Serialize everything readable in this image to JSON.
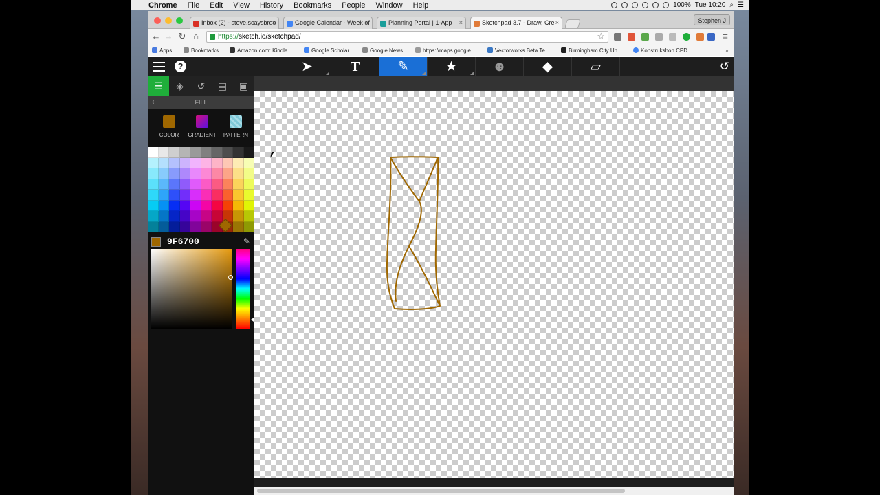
{
  "menubar": {
    "app_name": "Chrome",
    "items": [
      "File",
      "Edit",
      "View",
      "History",
      "Bookmarks",
      "People",
      "Window",
      "Help"
    ],
    "battery": "100%",
    "clock": "Tue 10:20"
  },
  "browser": {
    "profile": "Stephen J",
    "tabs": [
      {
        "title": "Inbox (2) - steve.scaysbroo",
        "favicon_color": "#d93025"
      },
      {
        "title": "Google Calendar - Week of",
        "favicon_color": "#4285f4"
      },
      {
        "title": "Planning Portal | 1-App",
        "favicon_color": "#1a9e9a"
      },
      {
        "title": "Sketchpad 3.7 - Draw, Cre",
        "favicon_color": "#e07b39"
      }
    ],
    "active_tab": 3,
    "url_scheme": "https://",
    "url_rest": "sketch.io/sketchpad/",
    "bookmarks": [
      {
        "label": "Apps",
        "icon_color": "#4a7be0"
      },
      {
        "label": "Bookmarks",
        "icon_color": "#888888"
      },
      {
        "label": "Amazon.com: Kindle",
        "icon_color": "#333333"
      },
      {
        "label": "Google Scholar",
        "icon_color": "#4285f4"
      },
      {
        "label": "Google News",
        "icon_color": "#888888"
      },
      {
        "label": "https://maps.google",
        "icon_color": "#999999"
      },
      {
        "label": "Vectorworks Beta Te",
        "icon_color": "#3a78c4"
      },
      {
        "label": "Birmingham City Un",
        "icon_color": "#222222"
      },
      {
        "label": "Konstrukshon CPD",
        "icon_color": "#4285f4"
      }
    ]
  },
  "app": {
    "tools": [
      "select-tool",
      "text-tool",
      "pencil-tool",
      "stamp-tool",
      "emoji-tool",
      "fill-tool",
      "eraser-tool"
    ],
    "active_tool": "pencil-tool",
    "panel_header": "FILL",
    "fill_types": [
      {
        "label": "COLOR",
        "color": "#9F6700"
      },
      {
        "label": "GRADIENT",
        "color": "#8a1cd8"
      },
      {
        "label": "PATTERN",
        "color": "#7fc9d8"
      }
    ],
    "hex_value": "9F6700",
    "stroke_color": "#9F6700"
  }
}
